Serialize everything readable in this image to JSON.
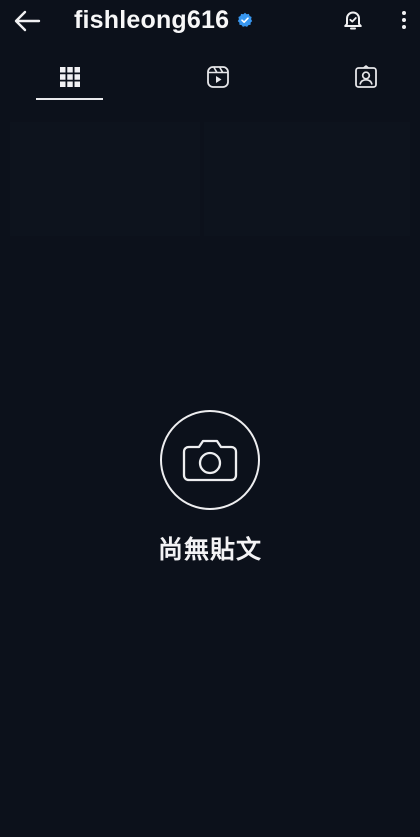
{
  "header": {
    "username": "fishleong616",
    "back_icon": "arrow-left-icon",
    "verified_icon": "verified-badge-icon",
    "verified_color": "#3897f0",
    "bell_icon": "notification-bell-icon",
    "more_icon": "more-vertical-icon"
  },
  "tabs": [
    {
      "name": "posts-grid",
      "icon": "grid-icon",
      "active": true
    },
    {
      "name": "reels",
      "icon": "reels-icon",
      "active": false
    },
    {
      "name": "tagged",
      "icon": "tagged-person-icon",
      "active": false
    }
  ],
  "empty_state": {
    "icon": "camera-icon",
    "message": "尚無貼文"
  },
  "colors": {
    "background": "#0c111b",
    "foreground": "#f4f4f6"
  }
}
